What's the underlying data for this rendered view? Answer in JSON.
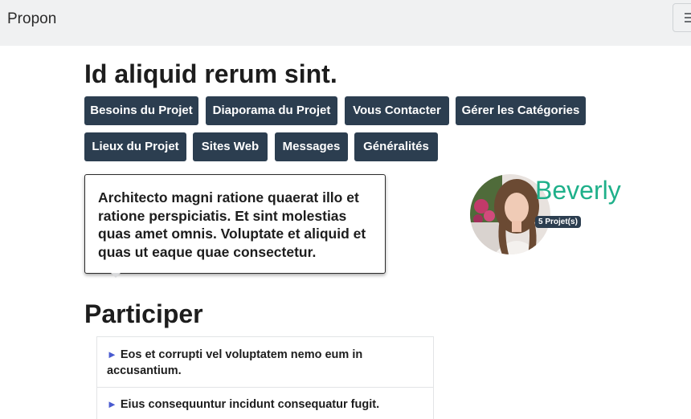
{
  "brand": "Propon",
  "project_title": "Id aliquid rerum sint.",
  "tabs": [
    "Besoins du Projet",
    "Diaporama du Projet",
    "Vous Contacter",
    "Gérer les Catégories",
    "Lieux du Projet",
    "Sites Web",
    "Messages",
    "Généralités"
  ],
  "description": "Architecto magni ratione quaerat illo et ratione perspiciatis. Et sint molestias quas amet omnis. Voluptate et aliquid et quas ut eaque quae consectetur.",
  "owner": {
    "name": "Beverly",
    "projects_badge": "5 Projet(s)"
  },
  "participate": {
    "heading": "Participer",
    "items": [
      "Eos et corrupti vel voluptatem nemo eum in accusantium.",
      "Eius consequuntur incidunt consequatur fugit."
    ]
  },
  "colors": {
    "navbar_bg": "#f0f1f2",
    "button_bg": "#2c3e50",
    "username": "#1fb08a",
    "arrow": "#4a5bd0"
  }
}
